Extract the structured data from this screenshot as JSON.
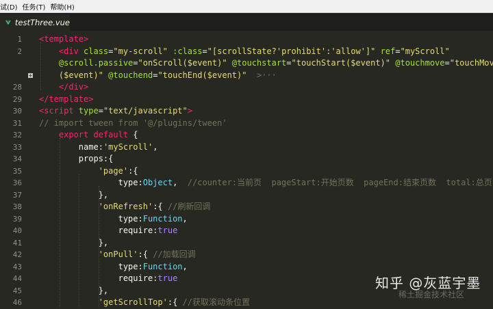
{
  "menu": [
    "试(D)",
    "任务(T)",
    "帮助(H)"
  ],
  "tab": {
    "filename": "testThree.vue"
  },
  "lines": [
    {
      "n": "1",
      "tokens": [
        [
          "<template>",
          "t"
        ]
      ]
    },
    {
      "n": "2",
      "tokens": [
        [
          "    ",
          ""
        ],
        [
          "<div ",
          "t"
        ],
        [
          "class",
          "a"
        ],
        [
          "=",
          ""
        ],
        [
          "\"my-scroll\"",
          "s"
        ],
        [
          " ",
          ""
        ],
        [
          ":class",
          "a"
        ],
        [
          "=",
          ""
        ],
        [
          "\"[scrollState?'prohibit':'allow']\"",
          "s"
        ],
        [
          " ",
          ""
        ],
        [
          "ref",
          "a"
        ],
        [
          "=",
          ""
        ],
        [
          "\"myScroll\"",
          "s"
        ]
      ]
    },
    {
      "n": "",
      "tokens": [
        [
          "    ",
          ""
        ],
        [
          "@scroll.passive",
          "a"
        ],
        [
          "=",
          ""
        ],
        [
          "\"onScroll($event)\"",
          "s"
        ],
        [
          " ",
          ""
        ],
        [
          "@touchstart",
          "a"
        ],
        [
          "=",
          ""
        ],
        [
          "\"touchStart($event)\"",
          "s"
        ],
        [
          " ",
          ""
        ],
        [
          "@touchmove",
          "a"
        ],
        [
          "=",
          ""
        ],
        [
          "\"touchMove",
          "s"
        ]
      ]
    },
    {
      "n": "",
      "fold": true,
      "tokens": [
        [
          "    ",
          ""
        ],
        [
          "($event)\"",
          "s"
        ],
        [
          " ",
          ""
        ],
        [
          "@touchend",
          "a"
        ],
        [
          "=",
          ""
        ],
        [
          "\"touchEnd($event)\"",
          "s"
        ],
        [
          "  ",
          ""
        ],
        [
          ">···",
          "d"
        ]
      ]
    },
    {
      "n": "28",
      "tokens": [
        [
          "    ",
          ""
        ],
        [
          "</div>",
          "t"
        ]
      ]
    },
    {
      "n": "29",
      "tokens": [
        [
          "</template>",
          "t"
        ]
      ]
    },
    {
      "n": "30",
      "tokens": [
        [
          "<script ",
          "t"
        ],
        [
          "type",
          "a"
        ],
        [
          "=",
          ""
        ],
        [
          "\"text/javascript\"",
          "s"
        ],
        [
          ">",
          "t"
        ]
      ]
    },
    {
      "n": "31",
      "tokens": [
        [
          "// import tween from '@/plugins/tween'",
          "c"
        ]
      ]
    },
    {
      "n": "32",
      "tokens": [
        [
          "    ",
          ""
        ],
        [
          "export ",
          "o"
        ],
        [
          "default ",
          "o"
        ],
        [
          "{",
          ""
        ]
      ]
    },
    {
      "n": "33",
      "tokens": [
        [
          "        name",
          ""
        ],
        [
          ":",
          ""
        ],
        [
          "'myScroll'",
          "s"
        ],
        [
          ",",
          ""
        ]
      ]
    },
    {
      "n": "34",
      "tokens": [
        [
          "        props",
          ""
        ],
        [
          ":{",
          ""
        ]
      ]
    },
    {
      "n": "35",
      "tokens": [
        [
          "            ",
          ""
        ],
        [
          "'page'",
          "s"
        ],
        [
          ":{",
          ""
        ]
      ]
    },
    {
      "n": "36",
      "tokens": [
        [
          "                type",
          ""
        ],
        [
          ":",
          ""
        ],
        [
          "Object",
          "k"
        ],
        [
          ",  ",
          ""
        ],
        [
          "//counter:当前页  pageStart:开始页数  pageEnd:结束页数  total:总页",
          "c"
        ]
      ]
    },
    {
      "n": "37",
      "tokens": [
        [
          "            },",
          ""
        ]
      ]
    },
    {
      "n": "38",
      "tokens": [
        [
          "            ",
          ""
        ],
        [
          "'onRefresh'",
          "s"
        ],
        [
          ":{ ",
          ""
        ],
        [
          "//刷新回调",
          "c"
        ]
      ]
    },
    {
      "n": "39",
      "tokens": [
        [
          "                type",
          ""
        ],
        [
          ":",
          ""
        ],
        [
          "Function",
          "k"
        ],
        [
          ",",
          ""
        ]
      ]
    },
    {
      "n": "40",
      "tokens": [
        [
          "                require",
          ""
        ],
        [
          ":",
          ""
        ],
        [
          "true",
          "n"
        ]
      ]
    },
    {
      "n": "41",
      "tokens": [
        [
          "            },",
          ""
        ]
      ]
    },
    {
      "n": "42",
      "tokens": [
        [
          "            ",
          ""
        ],
        [
          "'onPull'",
          "s"
        ],
        [
          ":{ ",
          ""
        ],
        [
          "//加载回调",
          "c"
        ]
      ]
    },
    {
      "n": "43",
      "tokens": [
        [
          "                type",
          ""
        ],
        [
          ":",
          ""
        ],
        [
          "Function",
          "k"
        ],
        [
          ",",
          ""
        ]
      ]
    },
    {
      "n": "44",
      "tokens": [
        [
          "                require",
          ""
        ],
        [
          ":",
          ""
        ],
        [
          "true",
          "n"
        ]
      ]
    },
    {
      "n": "45",
      "tokens": [
        [
          "            },",
          ""
        ]
      ]
    },
    {
      "n": "46",
      "tokens": [
        [
          "            ",
          ""
        ],
        [
          "'getScrollTop'",
          "s"
        ],
        [
          ":{ ",
          ""
        ],
        [
          "//获取滚动条位置",
          "c"
        ]
      ]
    }
  ],
  "watermark": {
    "brand": "知乎 @灰蓝宇墨",
    "sub": "稀土掘金技术社区"
  },
  "colors": {
    "background": "#272822",
    "tag": "#f92672",
    "attr": "#a6e22e",
    "string": "#e6db74",
    "comment": "#75715e",
    "type": "#66d9ef",
    "boolean": "#ae81ff"
  }
}
